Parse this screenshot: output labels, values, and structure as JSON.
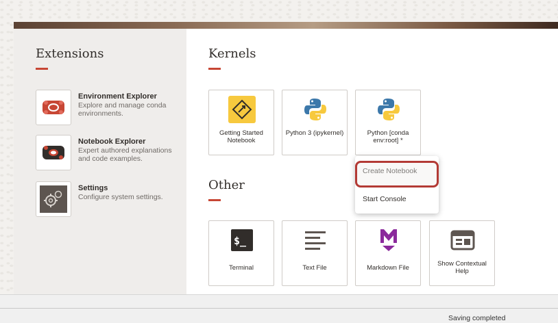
{
  "extensions": {
    "title": "Extensions",
    "items": [
      {
        "name": "Environment Explorer",
        "description": "Explore and manage conda environments.",
        "icon": "environment-explorer-icon"
      },
      {
        "name": "Notebook Explorer",
        "description": "Expert authored explanations and code examples.",
        "icon": "notebook-explorer-icon"
      },
      {
        "name": "Settings",
        "description": "Configure system settings.",
        "icon": "gear-icon"
      }
    ]
  },
  "kernels": {
    "title": "Kernels",
    "tiles": [
      {
        "label": "Getting Started Notebook",
        "icon": "getting-started-icon"
      },
      {
        "label": "Python 3 (ipykernel)",
        "icon": "python-icon"
      },
      {
        "label": "Python [conda env:root] *",
        "icon": "python-icon"
      }
    ]
  },
  "context_menu": {
    "items": [
      "Create Notebook",
      "Start Console"
    ]
  },
  "other": {
    "title": "Other",
    "tiles": [
      {
        "label": "Terminal",
        "icon": "terminal-icon"
      },
      {
        "label": "Text File",
        "icon": "text-file-icon"
      },
      {
        "label": "Markdown File",
        "icon": "markdown-icon"
      },
      {
        "label": "Show Contextual Help",
        "icon": "contextual-help-icon"
      }
    ]
  },
  "status": {
    "text": "Saving completed"
  },
  "colors": {
    "accent": "#c74634",
    "highlight": "#b33a35",
    "python_blue": "#3c78aa",
    "python_yellow": "#f7c93e",
    "markdown_purple": "#8b2a9c"
  }
}
